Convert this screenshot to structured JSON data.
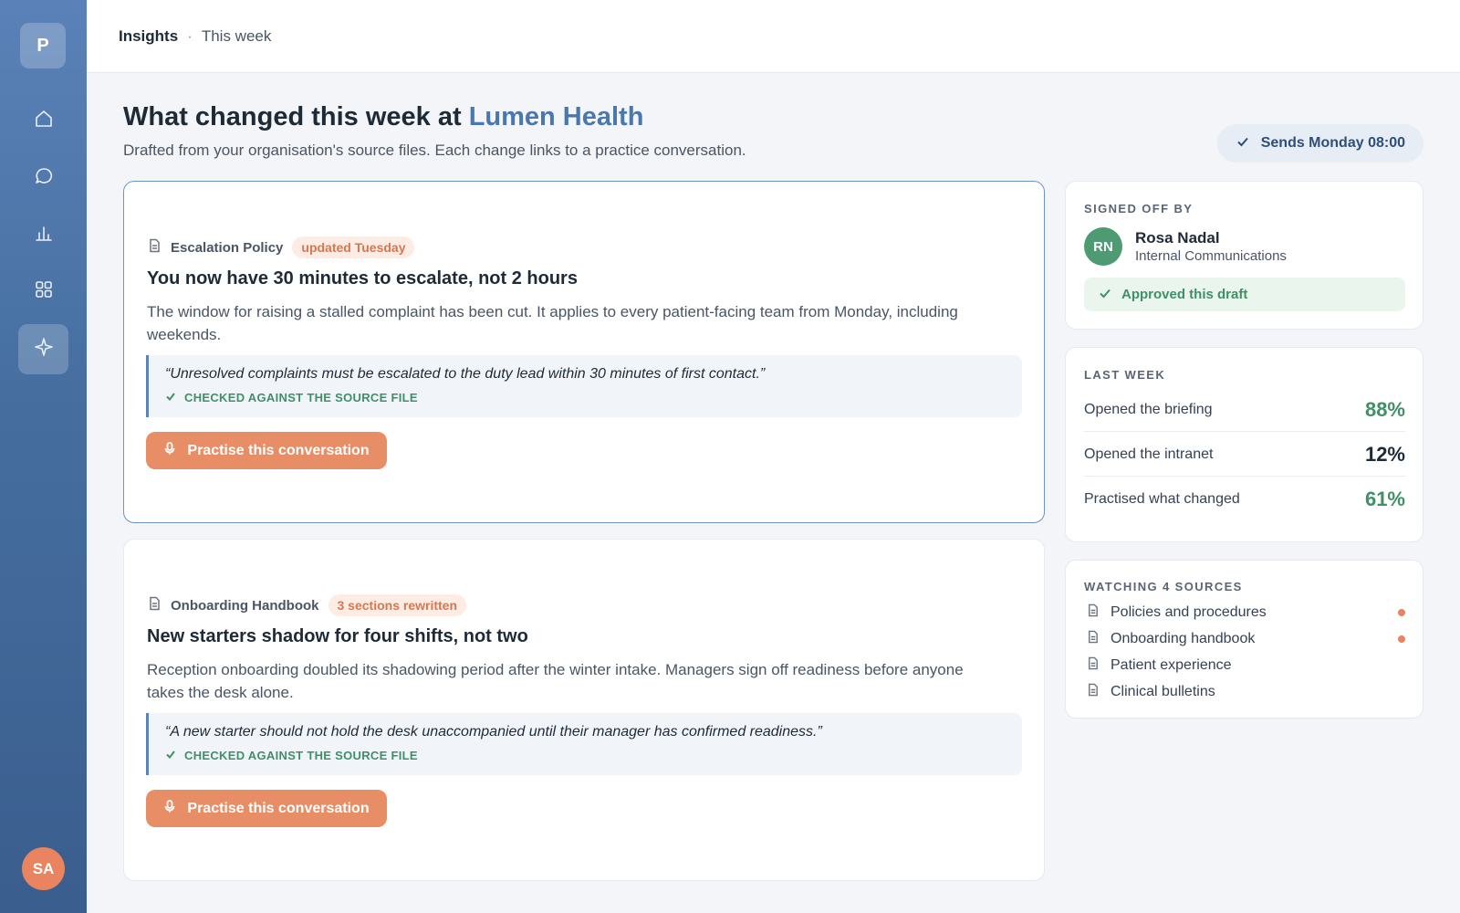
{
  "sidebar": {
    "logo": "P",
    "nav": [
      {
        "icon": "home-icon"
      },
      {
        "icon": "chat-icon"
      },
      {
        "icon": "bar-chart-icon"
      },
      {
        "icon": "grid-icon"
      },
      {
        "icon": "sparkle-icon",
        "active": true
      }
    ],
    "user_initials": "SA"
  },
  "breadcrumb": {
    "section": "Insights",
    "separator": "·",
    "period": "This week"
  },
  "header": {
    "title_prefix": "What changed this week at ",
    "org_name": "Lumen Health",
    "subtitle": "Drafted from your organisation's source files. Each change links to a practice conversation.",
    "sends_label": "Sends Monday 08:00"
  },
  "changes": [
    {
      "source": "Escalation Policy",
      "badge": "updated Tuesday",
      "title": "You now have 30 minutes to escalate, not 2 hours",
      "description": "The window for raising a stalled complaint has been cut. It applies to every patient-facing team from Monday, including weekends.",
      "quote": "“Unresolved complaints must be escalated to the duty lead within 30 minutes of first contact.”",
      "checked_label": "CHECKED AGAINST THE SOURCE FILE",
      "button_label": "Practise this conversation"
    },
    {
      "source": "Onboarding Handbook",
      "badge": "3 sections rewritten",
      "title": "New starters shadow for four shifts, not two",
      "description": "Reception onboarding doubled its shadowing period after the winter intake. Managers sign off readiness before anyone takes the desk alone.",
      "quote": "“A new starter should not hold the desk unaccompanied until their manager has confirmed readiness.”",
      "checked_label": "CHECKED AGAINST THE SOURCE FILE",
      "button_label": "Practise this conversation"
    }
  ],
  "signoff": {
    "label": "SIGNED OFF BY",
    "initials": "RN",
    "name": "Rosa Nadal",
    "role": "Internal Communications",
    "approved_label": "Approved this draft"
  },
  "last_week": {
    "label": "LAST WEEK",
    "stats": [
      {
        "label": "Opened the briefing",
        "value": "88%"
      },
      {
        "label": "Opened the intranet",
        "value": "12%"
      },
      {
        "label": "Practised what changed",
        "value": "61%"
      }
    ]
  },
  "sources": {
    "label": "WATCHING 4 SOURCES",
    "items": [
      {
        "name": "Policies and procedures",
        "changed": true
      },
      {
        "name": "Onboarding handbook",
        "changed": true
      },
      {
        "name": "Patient experience",
        "changed": false
      },
      {
        "name": "Clinical bulletins",
        "changed": false
      }
    ]
  },
  "colors": {
    "accent": "#4a78ad",
    "action": "#e88e66",
    "positive": "#3f8f67",
    "badge": "#d8774f"
  }
}
